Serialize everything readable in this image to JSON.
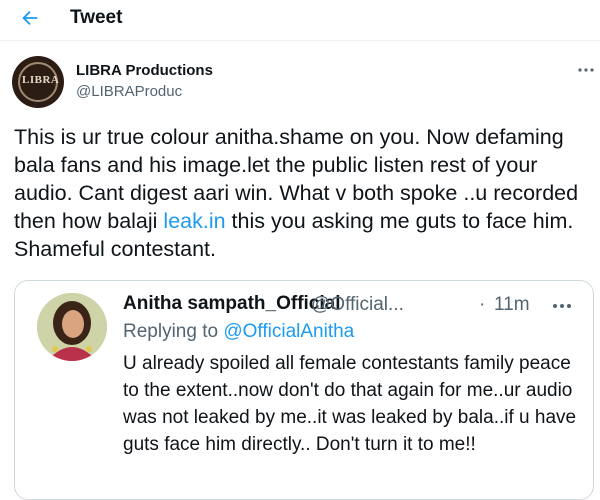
{
  "header": {
    "title": "Tweet"
  },
  "tweet": {
    "author_name": "LIBRA Productions",
    "author_handle": "@LIBRAProduc",
    "avatar_text": "LIBRA",
    "text_before_link": "This is ur true colour anitha.shame on you. Now defaming bala fans and his image.let the public listen rest of your audio. Cant digest aari win. What v both spoke ..u recorded then how balaji ",
    "link_text": "leak.in",
    "text_after_link": " this you asking me guts to face him. Shameful contestant."
  },
  "quote": {
    "author_name": "Anitha sampath_Official",
    "author_handle": "@Official...",
    "separator": "·",
    "time": "11m",
    "replying_prefix": "Replying to ",
    "replying_mention": "@OfficialAnitha",
    "text": "U already spoiled all female contestants family peace to the extent..now don't do that again for me..ur audio was not leaked by me..it was leaked by bala..if u have guts face him directly.. Don't turn it to me!!"
  },
  "icons": {
    "back": "arrow-left-icon",
    "more": "more-horizontal-icon"
  },
  "colors": {
    "accent": "#1d9bf0",
    "text": "#0f1419",
    "secondary": "#536471",
    "border": "#cfd9de"
  }
}
